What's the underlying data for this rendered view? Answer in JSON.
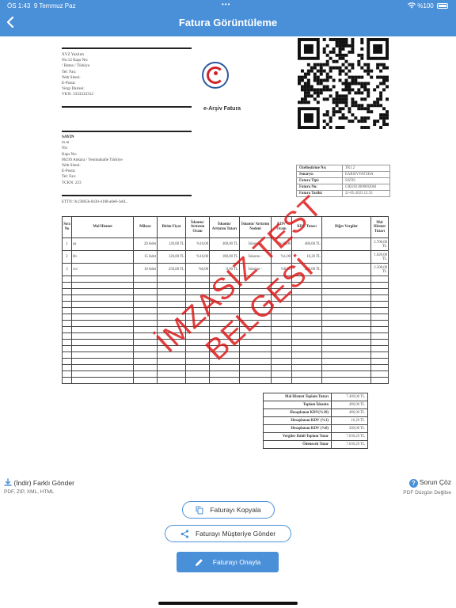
{
  "status_bar": {
    "time": "ÖS 1:43",
    "date": "9 Temmuz Paz",
    "dots": "•••",
    "battery": "%100"
  },
  "nav": {
    "title": "Fatura Görüntüleme",
    "back_icon": "chevron-left-icon"
  },
  "colors": {
    "accent": "#4a90d9",
    "stamp": "#dc1414"
  },
  "invoice": {
    "sender_lines": [
      "XYZ Yazılım",
      "No:12 Kapı No:",
      "/ Batna / Türkiye",
      "Tel: Fax:",
      "Web Sitesi:",
      "E-Posta:",
      "Vergi Dairesi:",
      "VKN: 3333333312"
    ],
    "logo_text": "e-Arşiv Fatura",
    "buyer_title": "SAYIN",
    "buyer_lines": [
      "m m",
      "No:",
      "Kapı No:",
      "06210 Ankara / Yenimahalle Türkiye",
      "Web Sitesi:",
      "E-Posta:",
      "Tel: Fax:",
      "TCKN: 223"
    ],
    "ettn": "ETTN: 9c23865b-0430-4108-a0e8-1ebf...",
    "info": [
      {
        "key": "Özelleştirme No:",
        "value": "TR1.2"
      },
      {
        "key": "Senaryo:",
        "value": "EARSIVFATURA"
      },
      {
        "key": "Fatura Tipi:",
        "value": "SATIS"
      },
      {
        "key": "Fatura No:",
        "value": "GIB2023000002084"
      },
      {
        "key": "Fatura Tarihi:",
        "value": "21-05-2023 12:33"
      }
    ],
    "columns": [
      "Sıra No",
      "Mal Hizmet",
      "Miktar",
      "Birim Fiyat",
      "İskonto/ Arttırım Oranı",
      "İskonto/ Arttırım Tutarı",
      "İskonto/ Arttırım Nedeni",
      "KDV Oranı",
      "KDV Tutarı",
      "Diğer Vergiler",
      "Mal Hizmet Tutarı"
    ],
    "rows": [
      [
        "1",
        "aa",
        "20 Adet",
        "120,00 TL",
        "%10,00",
        "300,00 TL",
        "İskonto -",
        "%18,00",
        "486,00 TL",
        "",
        "2.700,00 TL"
      ],
      [
        "2",
        "bb",
        "15 Adet",
        "120,00 TL",
        "%10,00",
        "180,00 TL",
        "İskonto -",
        "%1,00",
        "16,20 TL",
        "",
        "1.620,00 TL"
      ],
      [
        "3",
        "ccc",
        "10 Adet",
        "250,00 TL",
        "%0,00",
        "0,00 TL",
        "İskonto -",
        "%8,00",
        "200,00 TL",
        "",
        "2.500,00 TL"
      ]
    ],
    "totals": [
      {
        "key": "Mal Hizmet Toplam Tutarı",
        "value": "7.400,00 TL"
      },
      {
        "key": "Toplam İskonto",
        "value": "480,00 TL"
      },
      {
        "key": "Hesaplanan KDV(%18)",
        "value": "486,00 TL"
      },
      {
        "key": "Hesaplanan KDV (%1)",
        "value": "16,20 TL"
      },
      {
        "key": "Hesaplanan KDV (%8)",
        "value": "200,00 TL"
      },
      {
        "key": "Vergiler Dahil Toplam Tutar",
        "value": "7.630,20 TL"
      },
      {
        "key": "Ödenecek Tutar",
        "value": "7.630,20 TL"
      }
    ],
    "stamp_line1": "İMZASIZ TEST",
    "stamp_line2": "BELGESİ"
  },
  "actions": {
    "download_title": "(İndir) Farklı Gönder",
    "download_sub": "PDF, ZIP, XML, HTML",
    "help_title": "Sorun Çöz",
    "help_sub": "PDF Düzgün Değilse",
    "copy_label": "Faturayı Kopyala",
    "send_label": "Faturayı Müşteriye Gönder",
    "approve_label": "Faturayı Onayla"
  }
}
